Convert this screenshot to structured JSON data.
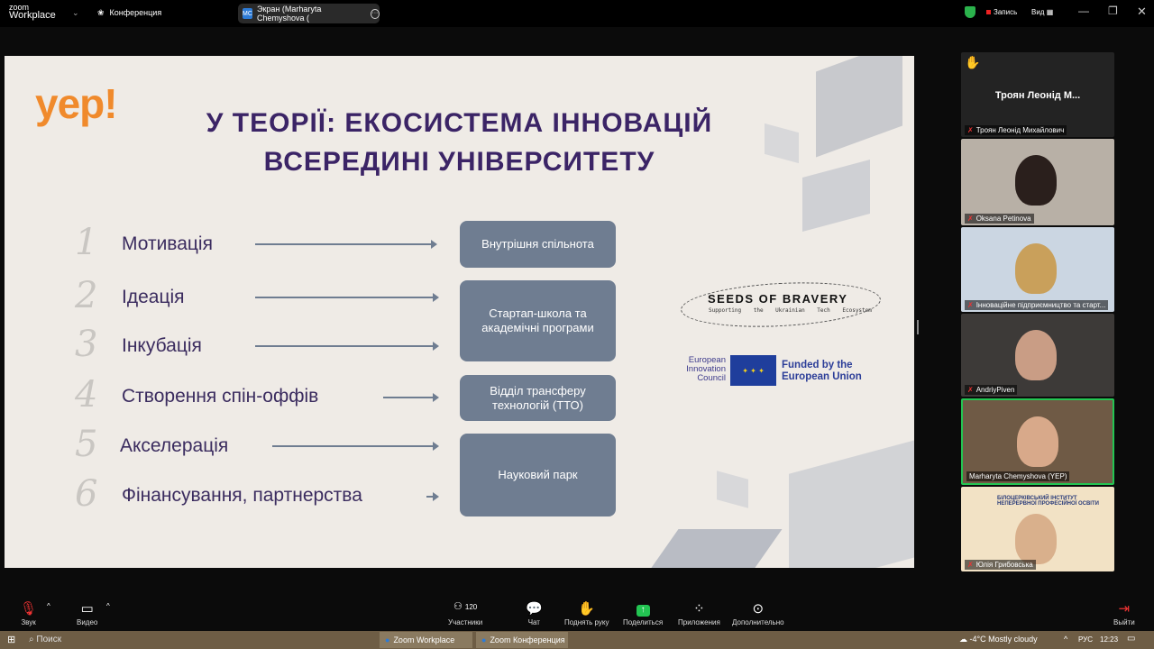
{
  "app": {
    "logo_small": "zoom",
    "logo_big": "Workplace",
    "meeting": "Конференция",
    "screen_share": "Экран (Marharyta Chemyshova (",
    "recording": "Запись",
    "view": "Вид",
    "view_chevron": "chevron-down-icon"
  },
  "slide": {
    "logo": "yep!",
    "title_line1": "У ТЕОРІЇ: ЕКОСИСТЕМА ІННОВАЦІЙ",
    "title_line2": "ВСЕРЕДИНІ УНІВЕРСИТЕТУ",
    "stages": [
      {
        "num": "1",
        "label": "Мотивація"
      },
      {
        "num": "2",
        "label": "Ідеація"
      },
      {
        "num": "3",
        "label": "Інкубація"
      },
      {
        "num": "4",
        "label": "Створення спін-оффів"
      },
      {
        "num": "5",
        "label": "Акселерація"
      },
      {
        "num": "6",
        "label": "Фінансування, партнерства"
      }
    ],
    "boxes": [
      "Внутрішня спільнота",
      "Стартап-школа та академічні програми",
      "Відділ трансферу технологій (ТТО)",
      "Науковий парк"
    ],
    "seeds_title": "SEEDS OF BRAVERY",
    "seeds_sub": "Supporting the Ukrainian Tech Ecosystem",
    "eic": "European Innovation Council",
    "eu_funded": "Funded by the European Union",
    "colors": {
      "title": "#3b2466",
      "logo": "#f08a2c",
      "box": "#6f7d91",
      "background": "#efebe6"
    }
  },
  "participants": [
    {
      "display": "Троян  Леонід М...",
      "name": "Троян Леонід Михайлович",
      "hand_raised": true
    },
    {
      "name": "Oksana Petinova"
    },
    {
      "name": "Інноваційне підприємництво та старт..."
    },
    {
      "name": "AndriyPiven"
    },
    {
      "name": "Marharyta Chemyshova (YEP)",
      "speaking": true
    },
    {
      "name": "Юлія Грибовська",
      "bg_text": "БІЛОЦЕРКІВСЬКИЙ ІНСТИТУТ НЕПЕРЕРВНОЇ ПРОФЕСІЙНОЇ ОСВІТИ"
    }
  ],
  "toolbar": {
    "audio": "Звук",
    "video": "Видео",
    "participants": "Участники",
    "participants_count": "120",
    "chat": "Чат",
    "raise_hand": "Поднять руку",
    "share": "Поделиться",
    "apps": "Приложения",
    "more": "Дополнительно",
    "leave": "Выйти"
  },
  "taskbar": {
    "search": "Поиск",
    "task1": "Zoom Workplace",
    "task2": "Zoom Конференция",
    "weather": "-4°C  Mostly cloudy",
    "lang": "РУС",
    "time": "12:23"
  }
}
